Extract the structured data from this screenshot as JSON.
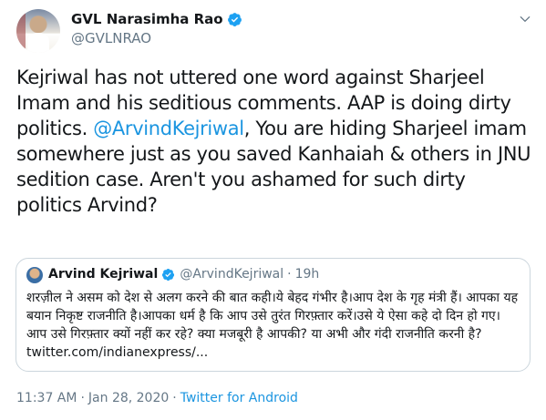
{
  "author": {
    "name": "GVL Narasimha Rao",
    "handle": "@GVLNRAO"
  },
  "tweet": {
    "text_before": "Kejriwal has not uttered one word against Sharjeel Imam and his seditious comments. AAP is doing dirty politics. ",
    "mention": "@ArvindKejriwal",
    "text_after": ", You are hiding Sharjeel imam somewhere just as you saved Kanhaiah & others in JNU sedition case. Aren't you ashamed for such dirty politics Arvind?"
  },
  "quoted": {
    "name": "Arvind Kejriwal",
    "handle": "@ArvindKejriwal",
    "separator": "·",
    "time": "19h",
    "text": "शरज़ील ने असम को देश से अलग करने की बात कही।ये बेहद गंभीर है।आप देश के गृह मंत्री हैं। आपका यह बयान निकृष्ट राजनीति है।आपका धर्म है कि आप उसे तुरंत गिरफ़्तार करें।उसे ये ऐसा कहे दो दिन हो गए। आप उसे गिरफ़्तार क्यों नहीं कर रहे? क्या मजबूरी है आपकी? या अभी और गंदी राजनीति करनी है? twitter.com/indianexpress/..."
  },
  "meta": {
    "time": "11:37 AM",
    "separator": "·",
    "date": "Jan 28, 2020",
    "source": "Twitter for Android"
  },
  "icons": {
    "verified": "verified-badge-icon",
    "menu": "chevron-down-icon"
  },
  "colors": {
    "link": "#1b95e0",
    "secondary_text": "#657786",
    "verified": "#1da1f2"
  }
}
